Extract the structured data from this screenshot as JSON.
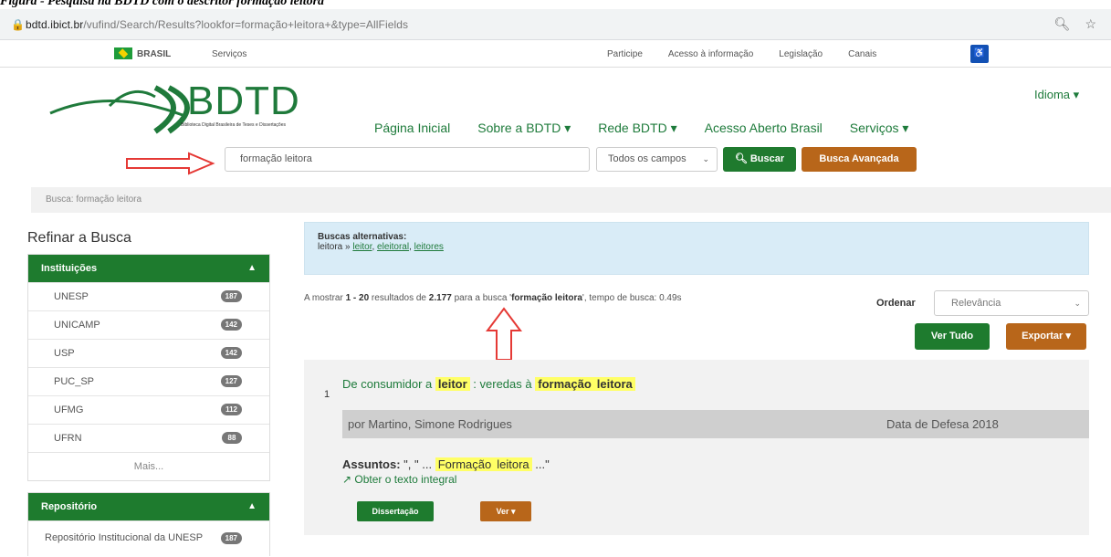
{
  "caption": "Figura - Pesquisa na BDTD com o descritor formação leitora",
  "browser": {
    "url_main": "bdtd.ibict.br",
    "url_path": "/vufind/Search/Results?lookfor=formação+leitora+&type=AllFields",
    "icons": [
      "zoom-icon",
      "star-icon"
    ]
  },
  "gov": {
    "brasil": "BRASIL",
    "servicos": "Serviços",
    "links": [
      "Participe",
      "Acesso à informação",
      "Legislação",
      "Canais"
    ]
  },
  "logo": {
    "name": "BDTD",
    "subtitle": "Biblioteca Digital Brasileira de Teses e Dissertações"
  },
  "nav": {
    "items": [
      "Página Inicial",
      "Sobre a BDTD ▾",
      "Rede BDTD ▾",
      "Acesso Aberto Brasil",
      "Serviços ▾"
    ],
    "idioma": "Idioma ▾"
  },
  "search": {
    "value": "formação leitora",
    "field_select": "Todos os campos",
    "buscar_label": "Buscar",
    "avancada_label": "Busca Avançada"
  },
  "breadcrumb": "Busca: formação leitora",
  "sidebar": {
    "title": "Refinar a Busca",
    "instituicoes": {
      "header": "Instituições",
      "items": [
        {
          "label": "UNESP",
          "count": "187"
        },
        {
          "label": "UNICAMP",
          "count": "142"
        },
        {
          "label": "USP",
          "count": "142"
        },
        {
          "label": "PUC_SP",
          "count": "127"
        },
        {
          "label": "UFMG",
          "count": "112"
        },
        {
          "label": "UFRN",
          "count": "88"
        }
      ],
      "more": "Mais..."
    },
    "repositorio": {
      "header": "Repositório",
      "items": [
        {
          "label": "Repositório Institucional da UNESP",
          "count": "187"
        }
      ]
    }
  },
  "alternatives": {
    "title": "Buscas alternativas:",
    "prefix": "leitora » ",
    "links": [
      "leitor",
      "eleitoral",
      "leitores"
    ]
  },
  "results": {
    "prefix": "A mostrar ",
    "range": "1 - 20",
    "mid": " resultados de ",
    "total": "2.177",
    "query_prefix": " para a busca '",
    "query": "formação leitora",
    "suffix": "', tempo de busca: 0.49s",
    "ordenar_label": "Ordenar",
    "ordenar_value": "Relevância",
    "ver_tudo": "Ver Tudo",
    "exportar": "Exportar ▾"
  },
  "result_item": {
    "number": "1",
    "title_pre": "De consumidor a ",
    "title_hl1": "leitor",
    "title_mid": " : veredas à ",
    "title_hl2": "formação",
    "title_hl3": "leitora",
    "author_label": "por Martino, Simone Rodrigues",
    "date_label": "Data de Defesa 2018",
    "subjects_label": "Assuntos:",
    "subjects_pre": " \", \" ... ",
    "subjects_hl1": "Formação",
    "subjects_hl2": "leitora",
    "subjects_post": " ...\"",
    "link_label": "Obter o texto integral",
    "type_badge": "Dissertação",
    "ver_label": "Ver ▾"
  },
  "colors": {
    "green": "#1e7b2e",
    "orange": "#b8661a",
    "highlight": "#ffff66",
    "annotation": "#e53935"
  }
}
